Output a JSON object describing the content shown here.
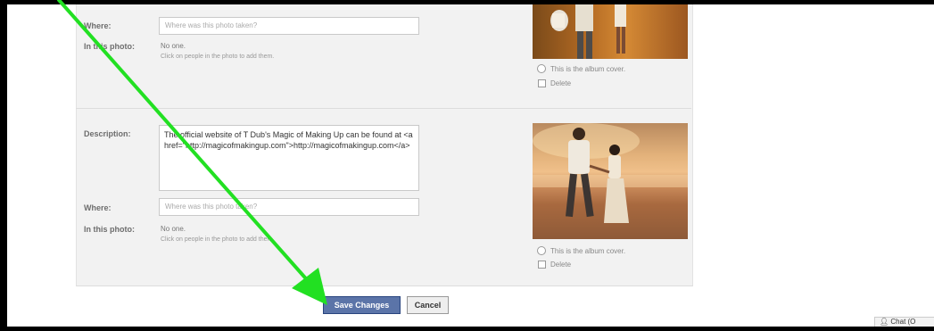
{
  "labels": {
    "description": "Description:",
    "where": "Where:",
    "in_this_photo": "In this photo:"
  },
  "photo_1": {
    "where_placeholder": "Where was this photo taken?",
    "tagged_value": "No one.",
    "tag_hint": "Click on people in the photo to add them.",
    "album_cover_label": "This is the album cover.",
    "delete_label": "Delete"
  },
  "photo_2": {
    "description": "The official website of T Dub's Magic of Making Up can be found at <a href=\"http://magicofmakingup.com\">http://magicofmakingup.com</a>",
    "where_placeholder": "Where was this photo taken?",
    "tagged_value": "No one.",
    "tag_hint": "Click on people in the photo to add them.",
    "album_cover_label": "This is the album cover.",
    "delete_label": "Delete"
  },
  "buttons": {
    "save": "Save Changes",
    "cancel": "Cancel"
  },
  "chat": {
    "label": "Chat (O"
  },
  "icons": [
    "person-chat-icon",
    "annotation-arrow"
  ],
  "colors": {
    "arrow": "#22e022",
    "save_button": "#5b74a8",
    "panel": "#f2f2f2"
  }
}
